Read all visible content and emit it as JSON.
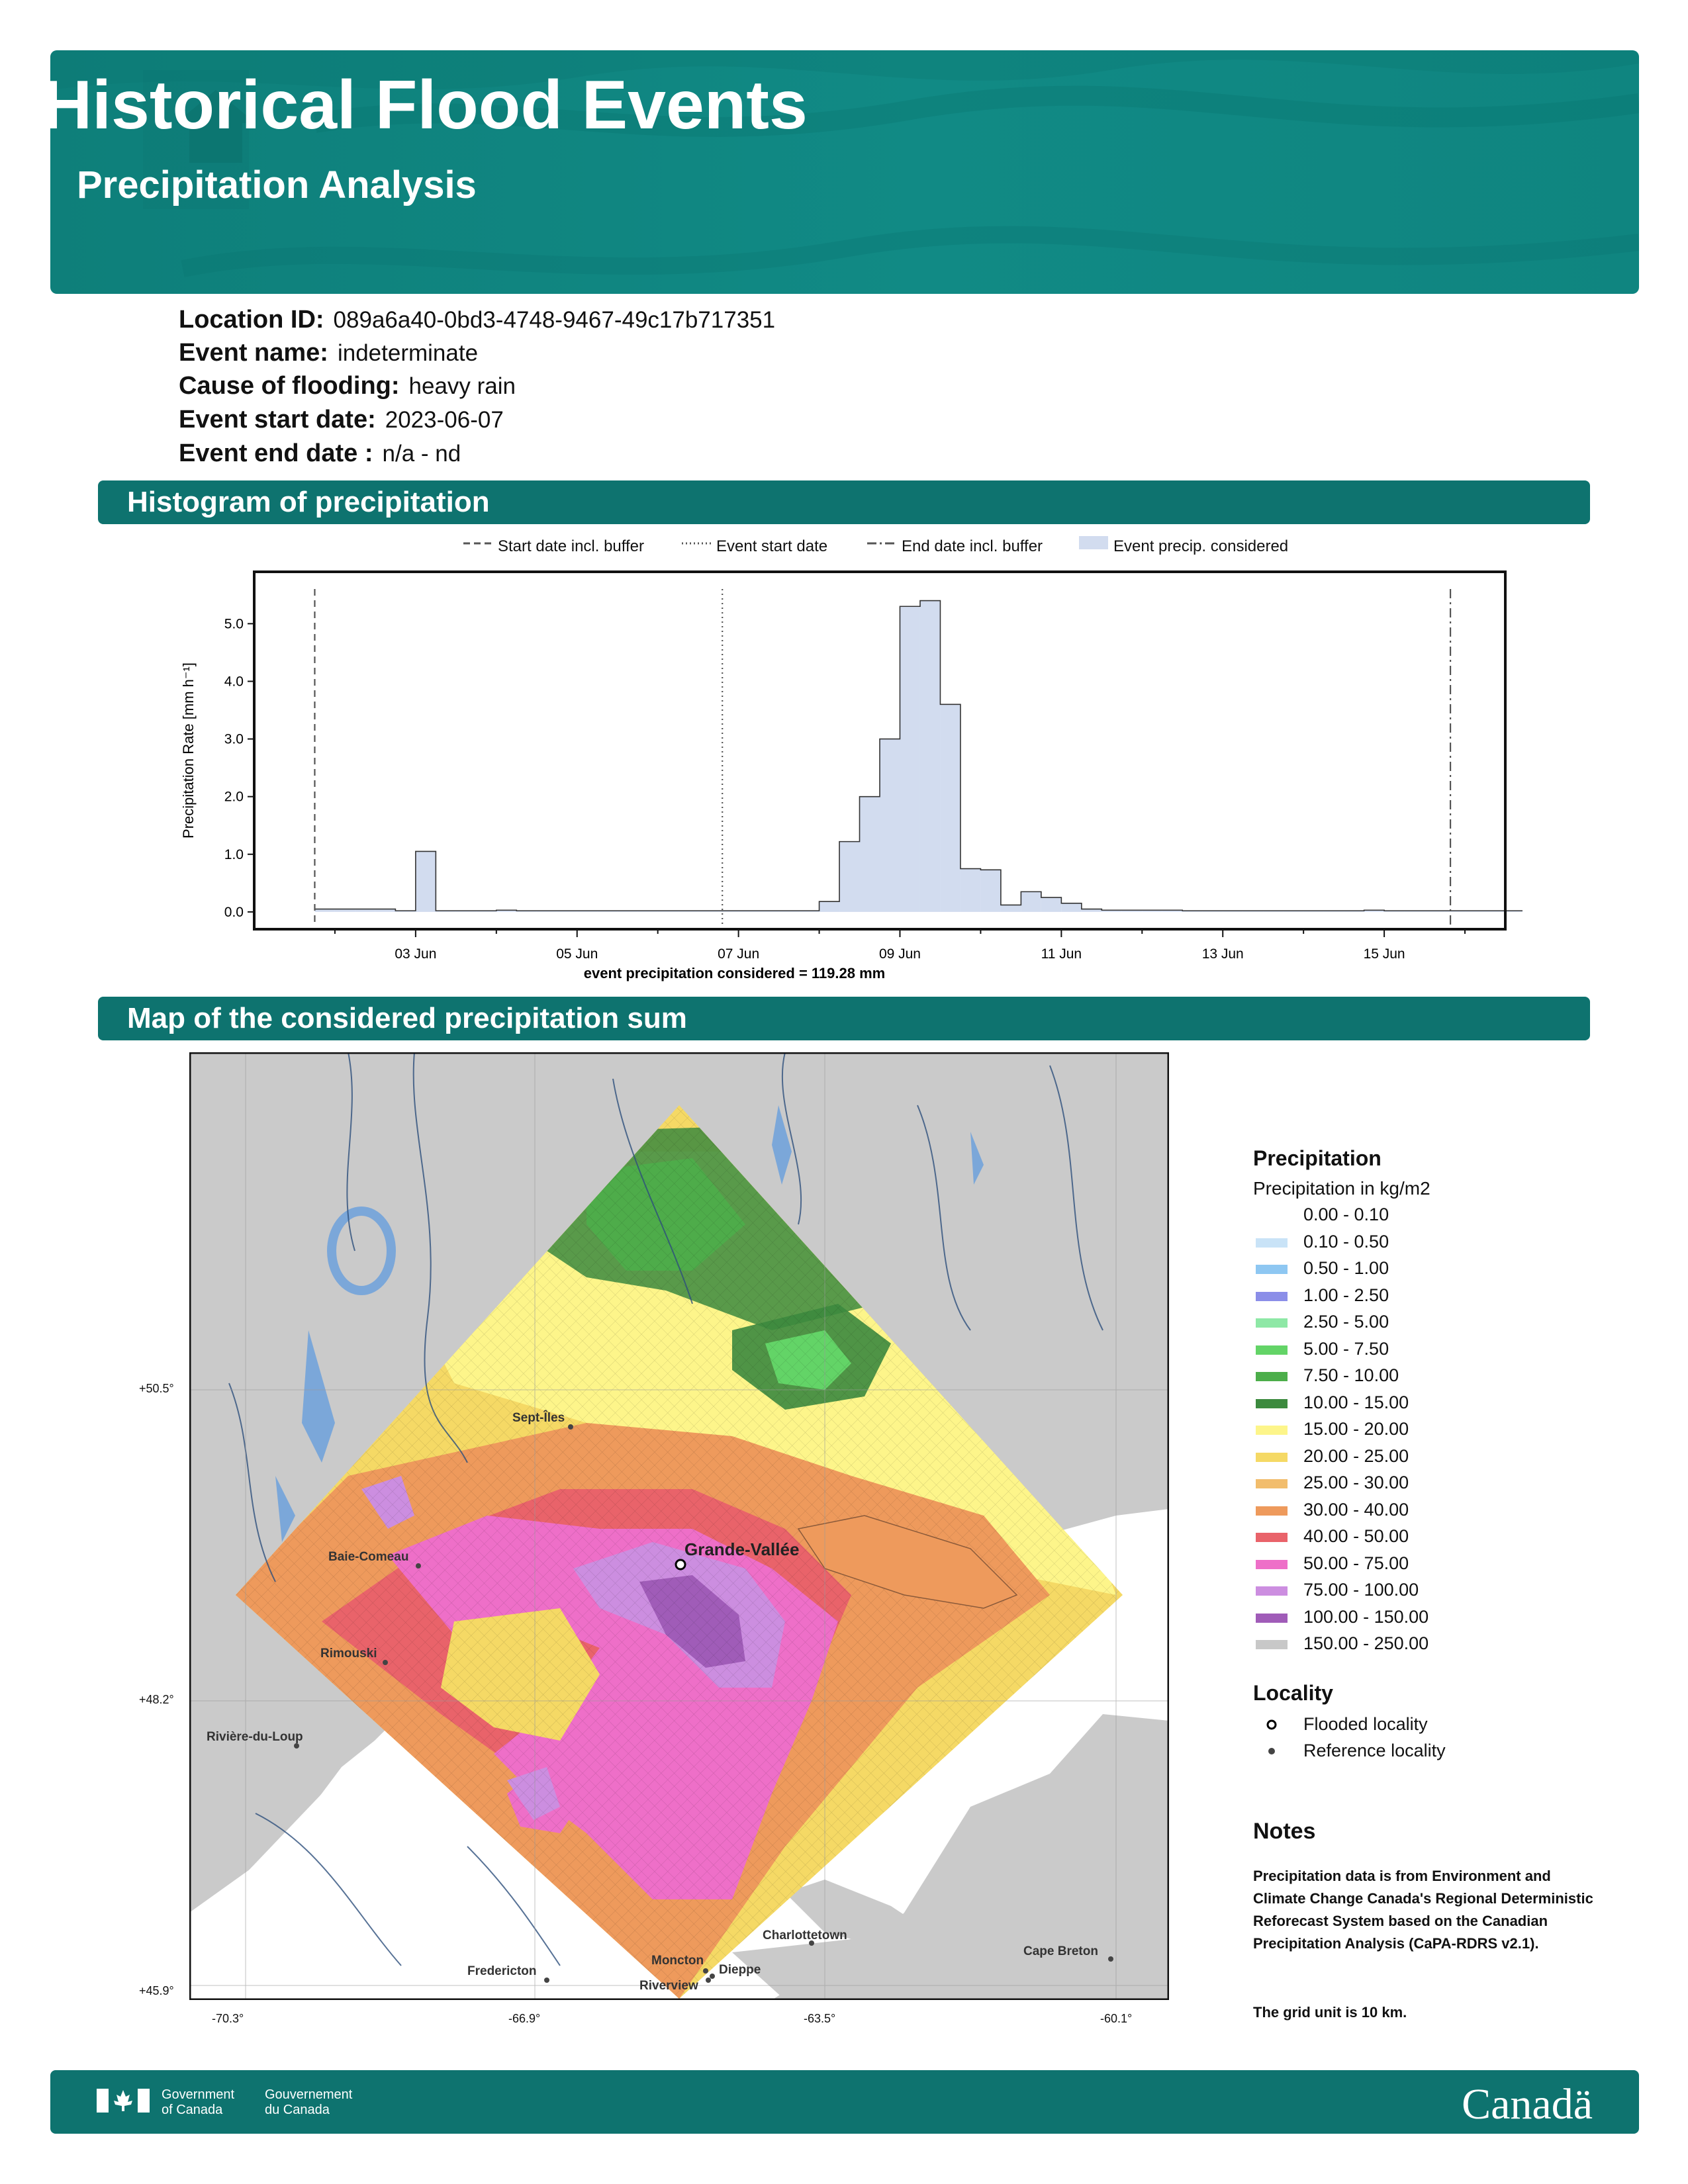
{
  "header": {
    "title": "Historical Flood Events",
    "subtitle": "Precipitation Analysis"
  },
  "event_info": [
    {
      "label": "Location ID:",
      "value": "089a6a40-0bd3-4748-9467-49c17b717351"
    },
    {
      "label": "Event name:",
      "value": "indeterminate"
    },
    {
      "label": "Cause of flooding:",
      "value": "heavy rain"
    },
    {
      "label": "Event start date:",
      "value": "2023-06-07"
    },
    {
      "label": "Event end date :",
      "value": "n/a - nd"
    }
  ],
  "sections": {
    "histogram": "Histogram of precipitation",
    "map": "Map of the considered precipitation sum"
  },
  "histogram_legend": {
    "start_buffer": "Start date incl. buffer",
    "event_start": "Event start date",
    "end_buffer": "End date incl. buffer",
    "event_precip": "Event precip. considered"
  },
  "chart_data": {
    "type": "bar",
    "ylabel": "Precipitation Rate [mm h⁻¹]",
    "ylim": [
      -0.3,
      5.9
    ],
    "yticks": [
      "0.0",
      "1.0",
      "2.0",
      "3.0",
      "4.0",
      "5.0"
    ],
    "xticks": [
      "03 Jun",
      "05 Jun",
      "07 Jun",
      "09 Jun",
      "11 Jun",
      "13 Jun",
      "15 Jun"
    ],
    "xlim_days": [
      1.0,
      16.5
    ],
    "start_buffer_day": 1.75,
    "event_start_day": 6.8,
    "end_buffer_day": 15.82,
    "summary": "event precipitation considered = 119.28 mm",
    "bar_width_days": 0.25,
    "values": [
      0.05,
      0.05,
      0.05,
      0.05,
      0.02,
      1.05,
      0.02,
      0.02,
      0.02,
      0.03,
      0.02,
      0.02,
      0.02,
      0.02,
      0.02,
      0.02,
      0.02,
      0.02,
      0.02,
      0.02,
      0.02,
      0.02,
      0.02,
      0.02,
      0.02,
      0.18,
      1.22,
      2.0,
      3.0,
      5.3,
      5.4,
      3.6,
      0.75,
      0.73,
      0.12,
      0.35,
      0.25,
      0.15,
      0.05,
      0.03,
      0.03,
      0.03,
      0.03,
      0.02,
      0.02,
      0.02,
      0.02,
      0.02,
      0.02,
      0.02,
      0.02,
      0.02,
      0.03,
      0.02,
      0.02,
      0.02,
      0.02,
      0.02,
      0.02,
      0.02,
      0.02,
      0.02,
      0.03,
      0.02,
      0.02,
      0.02,
      0.02,
      0.02,
      0.03,
      0.02,
      0.02,
      0.02,
      0.02,
      0.02,
      0.02,
      0.02,
      0.03,
      0.03,
      0.03,
      0.05,
      0.05,
      0.08,
      0.1,
      0.12
    ]
  },
  "map": {
    "lat_labels": [
      "+50.5°",
      "+48.2°",
      "+45.9°"
    ],
    "lon_labels": [
      "-70.3°",
      "-66.9°",
      "-63.5°",
      "-60.1°"
    ],
    "flooded_locality": "Grande-Vallée",
    "reference_localities": [
      "Sept-Îles",
      "Baie-Comeau",
      "Rimouski",
      "Rivière-du-Loup",
      "Fredericton",
      "Moncton",
      "Dieppe",
      "Riverview",
      "Charlottetown",
      "Cape Breton"
    ]
  },
  "map_legend": {
    "title": "Precipitation",
    "subtitle": "Precipitation in kg/m2",
    "classes": [
      {
        "label": "0.00 - 0.10",
        "color": "#ffffff"
      },
      {
        "label": "0.10 - 0.50",
        "color": "#c9e3f7"
      },
      {
        "label": "0.50 - 1.00",
        "color": "#8ec7f2"
      },
      {
        "label": "1.00 - 2.50",
        "color": "#8b8ee8"
      },
      {
        "label": "2.50 - 5.00",
        "color": "#8ee8a6"
      },
      {
        "label": "5.00 - 7.50",
        "color": "#63d467"
      },
      {
        "label": "7.50 - 10.00",
        "color": "#4cae4a"
      },
      {
        "label": "10.00 - 15.00",
        "color": "#3c8a3e"
      },
      {
        "label": "15.00 - 20.00",
        "color": "#fdf58a"
      },
      {
        "label": "20.00 - 25.00",
        "color": "#f5d965"
      },
      {
        "label": "25.00 - 30.00",
        "color": "#f2bd6c"
      },
      {
        "label": "30.00 - 40.00",
        "color": "#ee9a5c"
      },
      {
        "label": "40.00 - 50.00",
        "color": "#e9636a"
      },
      {
        "label": "50.00 - 75.00",
        "color": "#ee6fc8"
      },
      {
        "label": "75.00 - 100.00",
        "color": "#cc8ee0"
      },
      {
        "label": "100.00 - 150.00",
        "color": "#a05cb8"
      },
      {
        "label": "150.00 - 250.00",
        "color": "#c8c8c8"
      }
    ],
    "locality_title": "Locality",
    "flooded_label": "Flooded locality",
    "reference_label": "Reference locality"
  },
  "notes": {
    "title": "Notes",
    "text": "Precipitation data is from Environment and Climate Change Canada's Regional Deterministic Reforecast System based on the Canadian Precipitation Analysis (CaPA-RDRS v2.1).",
    "grid": "The grid unit is 10 km."
  },
  "footer": {
    "gov_en_1": "Government",
    "gov_en_2": "of Canada",
    "gov_fr_1": "Gouvernement",
    "gov_fr_2": "du Canada",
    "wordmark": "Canadä"
  }
}
